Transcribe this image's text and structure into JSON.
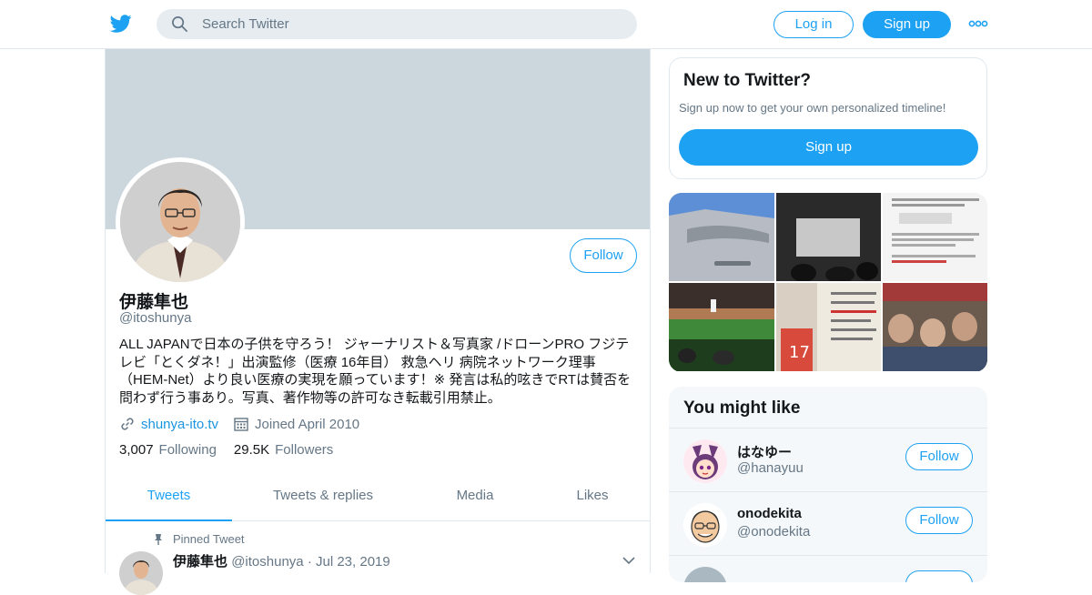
{
  "nav": {
    "search_placeholder": "Search Twitter",
    "login_label": "Log in",
    "signup_label": "Sign up",
    "logo_icon": "twitter-bird-icon",
    "more_icon": "more-dots-icon"
  },
  "profile": {
    "follow_label": "Follow",
    "name": "伊藤隼也",
    "handle": "@itoshunya",
    "bio": "ALL JAPANで日本の子供を守ろう！ ジャーナリスト＆写真家 /ドローンPRO フジテレビ「とくダネ！」出演監修（医療 16年目） 救急ヘリ 病院ネットワーク理事（HEM-Net）より良い医療の実現を願っています！※ 発言は私的呟きでRTは賛否を問わず行う事あり。写真、著作物等の許可なき転載引用禁止。",
    "website": "shunya-ito.tv",
    "joined": "Joined April 2010",
    "following_count": "3,007",
    "following_label": "Following",
    "followers_count": "29.5K",
    "followers_label": "Followers"
  },
  "tabs": [
    "Tweets",
    "Tweets & replies",
    "Media",
    "Likes"
  ],
  "pinned": {
    "label": "Pinned Tweet",
    "name": "伊藤隼也",
    "handle": "@itoshunya",
    "date": "Jul 23, 2019"
  },
  "signup_card": {
    "title": "New to Twitter?",
    "desc": "Sign up now to get your own personalized timeline!",
    "button": "Sign up"
  },
  "you_might_like": {
    "title": "You might like",
    "users": [
      {
        "name": "はなゆー",
        "handle": "@hanayuu",
        "follow": "Follow"
      },
      {
        "name": "onodekita",
        "handle": "@onodekita",
        "follow": "Follow"
      },
      {
        "name": "",
        "handle": "",
        "follow": ""
      }
    ]
  },
  "colors": {
    "accent": "#1da1f2",
    "banner": "#ccd6dd",
    "muted": "#657786",
    "border": "#e1e8ed"
  }
}
